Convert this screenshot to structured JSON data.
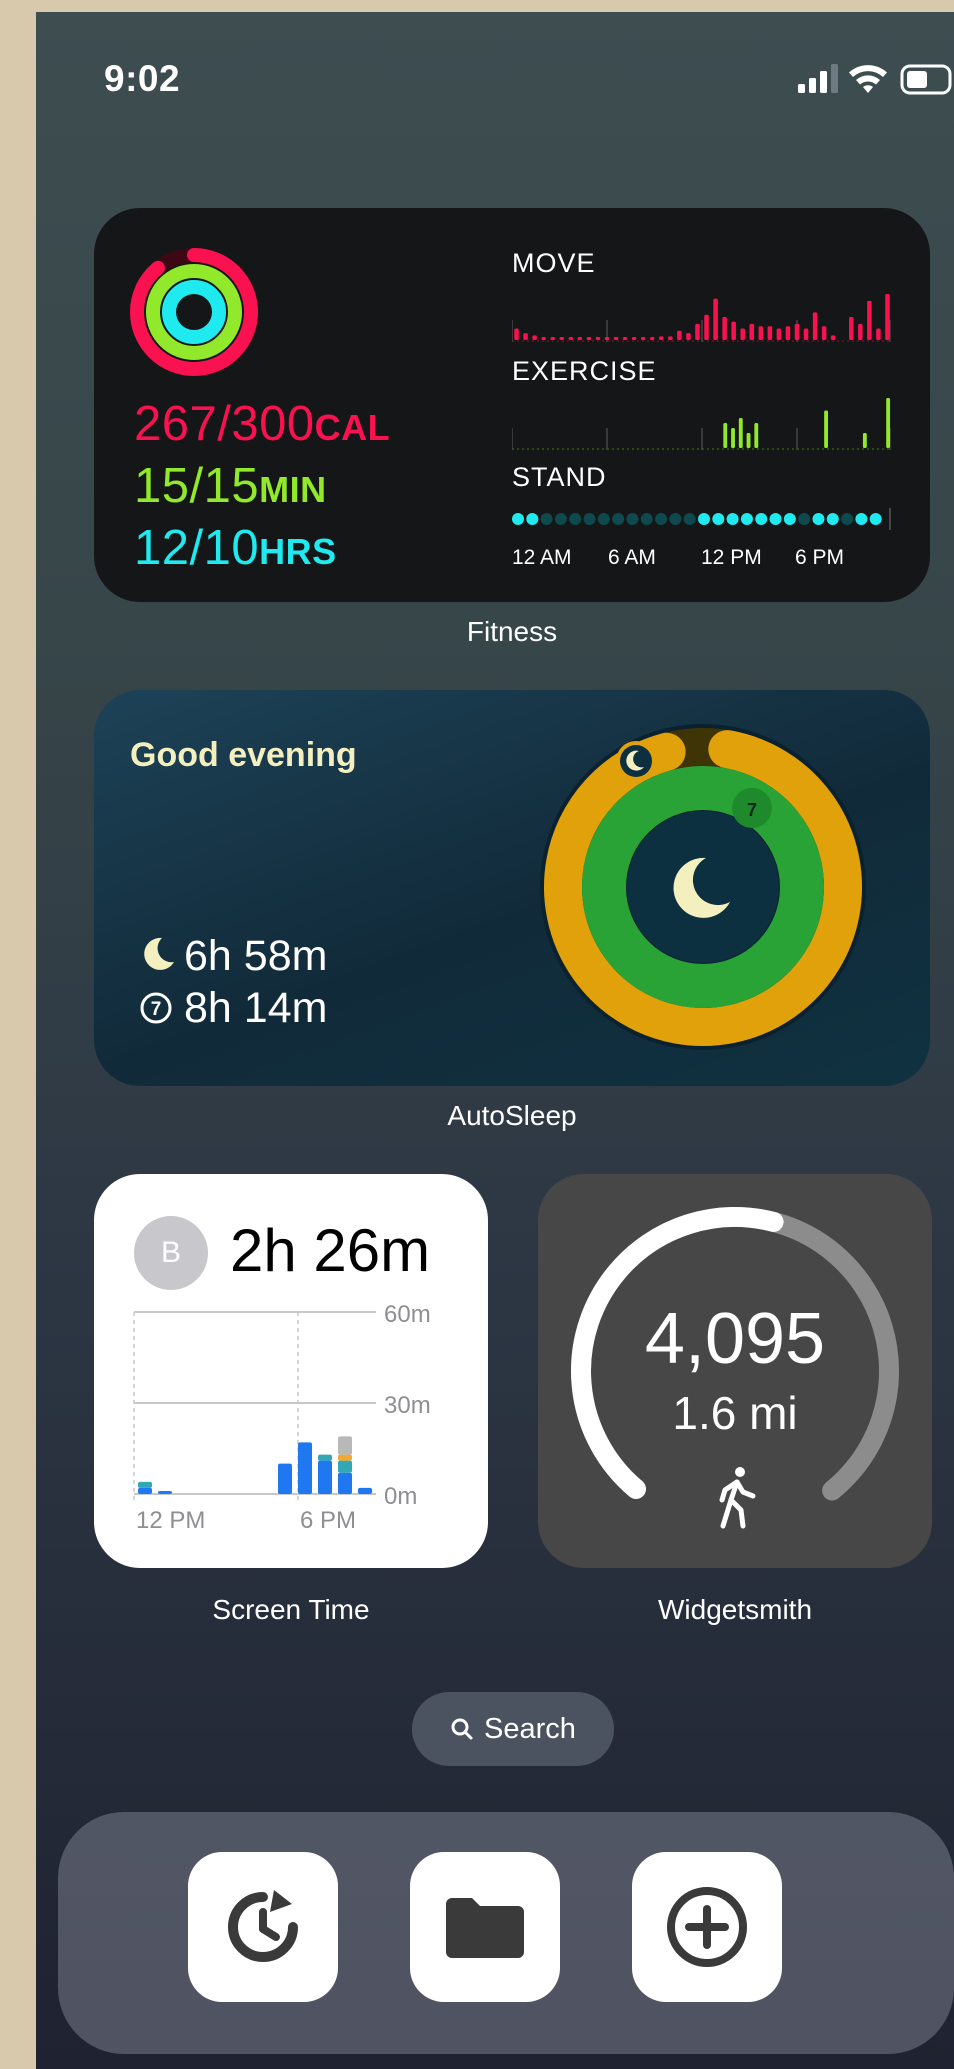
{
  "status_bar": {
    "time": "9:02",
    "signal_icon": "cellular-signal-icon",
    "wifi_icon": "wifi-icon",
    "battery_icon": "battery-icon"
  },
  "fitness_widget": {
    "move_value": "267/300",
    "move_unit": "CAL",
    "exercise_value": "15/15",
    "exercise_unit": "MIN",
    "stand_value": "12/10",
    "stand_unit": "HRS",
    "chart_labels": {
      "move": "MOVE",
      "exercise": "EXERCISE",
      "stand": "STAND"
    },
    "time_ticks": [
      "12 AM",
      "6 AM",
      "12 PM",
      "6 PM"
    ],
    "colors": {
      "move": "#fa114f",
      "exercise": "#92e82a",
      "stand": "#1eeaef"
    },
    "move_progress": 0.89,
    "exercise_progress": 1.0,
    "stand_progress": 1.2,
    "move_hourly": [
      0.25,
      0.15,
      0.1,
      0.05,
      0.05,
      0.05,
      0.05,
      0.05,
      0.05,
      0.05,
      0.05,
      0.05,
      0.05,
      0.05,
      0.05,
      0.05,
      0.08,
      0.08,
      0.2,
      0.15,
      0.35,
      0.55,
      0.9,
      0.5,
      0.4,
      0.25,
      0.35,
      0.3,
      0.3,
      0.25,
      0.3,
      0.35,
      0.25,
      0.6,
      0.3,
      0.1,
      0.0,
      0.5,
      0.35,
      0.85,
      0.25,
      1.0
    ],
    "exercise_hourly": [
      0,
      0,
      0,
      0,
      0,
      0,
      0,
      0,
      0,
      0,
      0,
      0,
      0,
      0,
      0,
      0,
      0,
      0,
      0,
      0,
      0,
      0,
      0,
      0,
      0,
      0,
      0,
      0.5,
      0.4,
      0.6,
      0.3,
      0.5,
      0,
      0,
      0,
      0,
      0,
      0,
      0,
      0,
      0.75,
      0,
      0,
      0,
      0,
      0.3,
      0,
      0,
      1.0
    ],
    "stand_hours": [
      1,
      1,
      0,
      0,
      0,
      0,
      0,
      0,
      0,
      0,
      0,
      0,
      0,
      1,
      1,
      1,
      1,
      1,
      1,
      1,
      0,
      1,
      1,
      0,
      1,
      1
    ]
  },
  "fitness_caption": "Fitness",
  "autosleep_widget": {
    "greeting": "Good evening",
    "sleep_duration": "6h 58m",
    "in_bed_duration": "8h 14m",
    "bed_badge": "7",
    "percent_label": "%",
    "colors": {
      "outer": "#e0a10b",
      "inner": "#29a336",
      "center": "#0c3040"
    },
    "outer_progress": 0.93,
    "inner_progress": 1.0
  },
  "autosleep_caption": "AutoSleep",
  "screen_time_widget": {
    "avatar_initial": "B",
    "total": "2h 26m",
    "y_labels": [
      "60m",
      "30m",
      "0m"
    ],
    "x_labels": [
      "12 PM",
      "6 PM"
    ],
    "bar_minutes": [
      {
        "blue": 2,
        "teal": 2,
        "orange": 0,
        "gray": 0
      },
      {
        "blue": 1,
        "teal": 0,
        "orange": 0,
        "gray": 0
      },
      {
        "blue": 0,
        "teal": 0,
        "orange": 0,
        "gray": 0
      },
      {
        "blue": 0,
        "teal": 0,
        "orange": 0,
        "gray": 0
      },
      {
        "blue": 0,
        "teal": 0,
        "orange": 0,
        "gray": 0
      },
      {
        "blue": 0,
        "teal": 0,
        "orange": 0,
        "gray": 0
      },
      {
        "blue": 0,
        "teal": 0,
        "orange": 0,
        "gray": 0
      },
      {
        "blue": 10,
        "teal": 0,
        "orange": 0,
        "gray": 0
      },
      {
        "blue": 17,
        "teal": 0,
        "orange": 0,
        "gray": 0
      },
      {
        "blue": 11,
        "teal": 2,
        "orange": 0,
        "gray": 0
      },
      {
        "blue": 7,
        "teal": 4,
        "orange": 2,
        "gray": 6
      },
      {
        "blue": 2,
        "teal": 0,
        "orange": 0,
        "gray": 0
      }
    ],
    "colors": {
      "blue": "#1f78f0",
      "teal": "#32a8b5",
      "orange": "#f0a830",
      "gray": "#b8b8b8"
    }
  },
  "screen_time_caption": "Screen Time",
  "widgetsmith_widget": {
    "steps": "4,095",
    "distance": "1.6 mi",
    "walk_icon": "walking-person-icon",
    "step_goal_progress": 0.55
  },
  "widgetsmith_caption": "Widgetsmith",
  "search_pill": {
    "label": "Search",
    "icon": "search-icon"
  },
  "dock": {
    "apps": [
      {
        "name": "clock-history-icon"
      },
      {
        "name": "folder-icon"
      },
      {
        "name": "add-circle-icon"
      }
    ]
  }
}
